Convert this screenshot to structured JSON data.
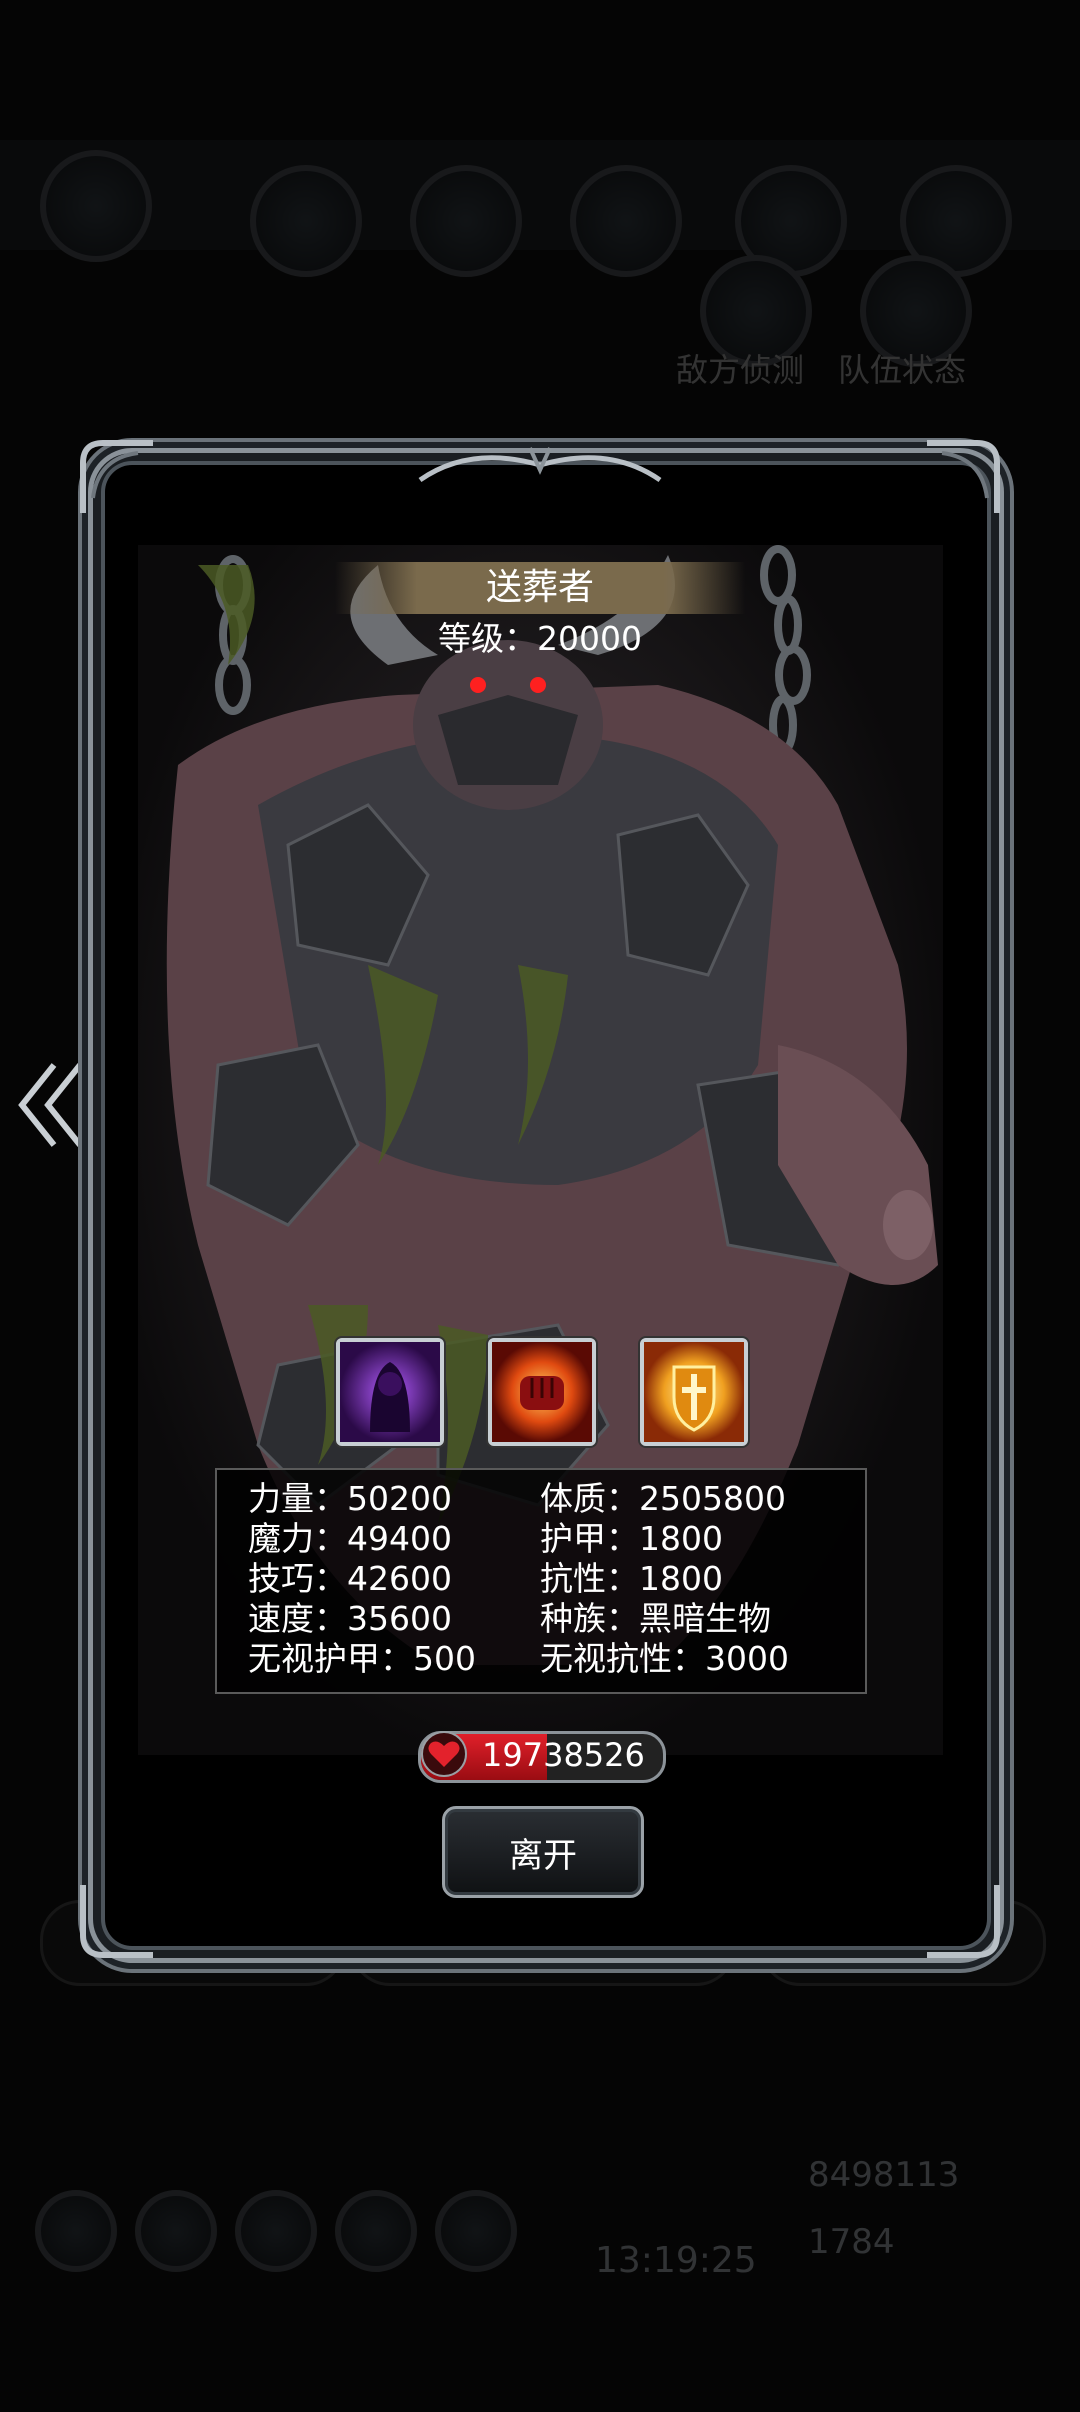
{
  "background": {
    "stats_line": "敌方侦测 | 队伍状态",
    "left_label": "敌方侦测",
    "right_label": "队伍状态",
    "clock": "13:19:25",
    "gold": "8498113",
    "gems": "1784"
  },
  "monster": {
    "name": "送葬者",
    "level_label": "等级：20000"
  },
  "skills": [
    {
      "icon": "shadow-skill-icon"
    },
    {
      "icon": "fist-skill-icon"
    },
    {
      "icon": "holy-shield-skill-icon"
    }
  ],
  "stats": {
    "left": [
      "力量：50200",
      "魔力：49400",
      "技巧：42600",
      "速度：35600",
      "无视护甲：500"
    ],
    "right": [
      "体质：2505800",
      "护甲：1800",
      "抗性：1800",
      "种族：黑暗生物",
      "无视抗性：3000"
    ]
  },
  "hp": {
    "value": "19738526",
    "fill_fraction": 0.52
  },
  "leave_button": "离开",
  "colors": {
    "hp_red": "#e0202a",
    "frame_silver": "#8a9299",
    "banner_gold": "#7a6a4c"
  }
}
